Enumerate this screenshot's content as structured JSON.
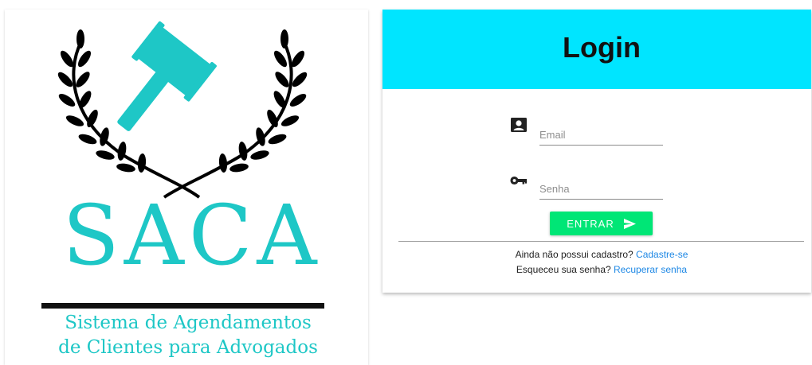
{
  "logo": {
    "name": "SACA",
    "tagline_line1": "Sistema de Agendamentos",
    "tagline_line2": "de Clientes para Advogados",
    "accent_color": "#1ec7c6",
    "icon": "gavel-with-laurel-wreath"
  },
  "login": {
    "title": "Login",
    "header_color": "#00e5ff",
    "email": {
      "placeholder": "Email",
      "value": "",
      "icon": "account-box-icon"
    },
    "password": {
      "placeholder": "Senha",
      "value": "",
      "icon": "key-icon"
    },
    "submit": {
      "label": "ENTRAR",
      "icon": "send-icon",
      "color": "#00e676"
    },
    "register_prompt": "Ainda não possui cadastro?",
    "register_link": "Cadastre-se",
    "recover_prompt": "Esqueceu sua senha?",
    "recover_link": "Recuperar senha",
    "link_color": "#1e88e5"
  }
}
